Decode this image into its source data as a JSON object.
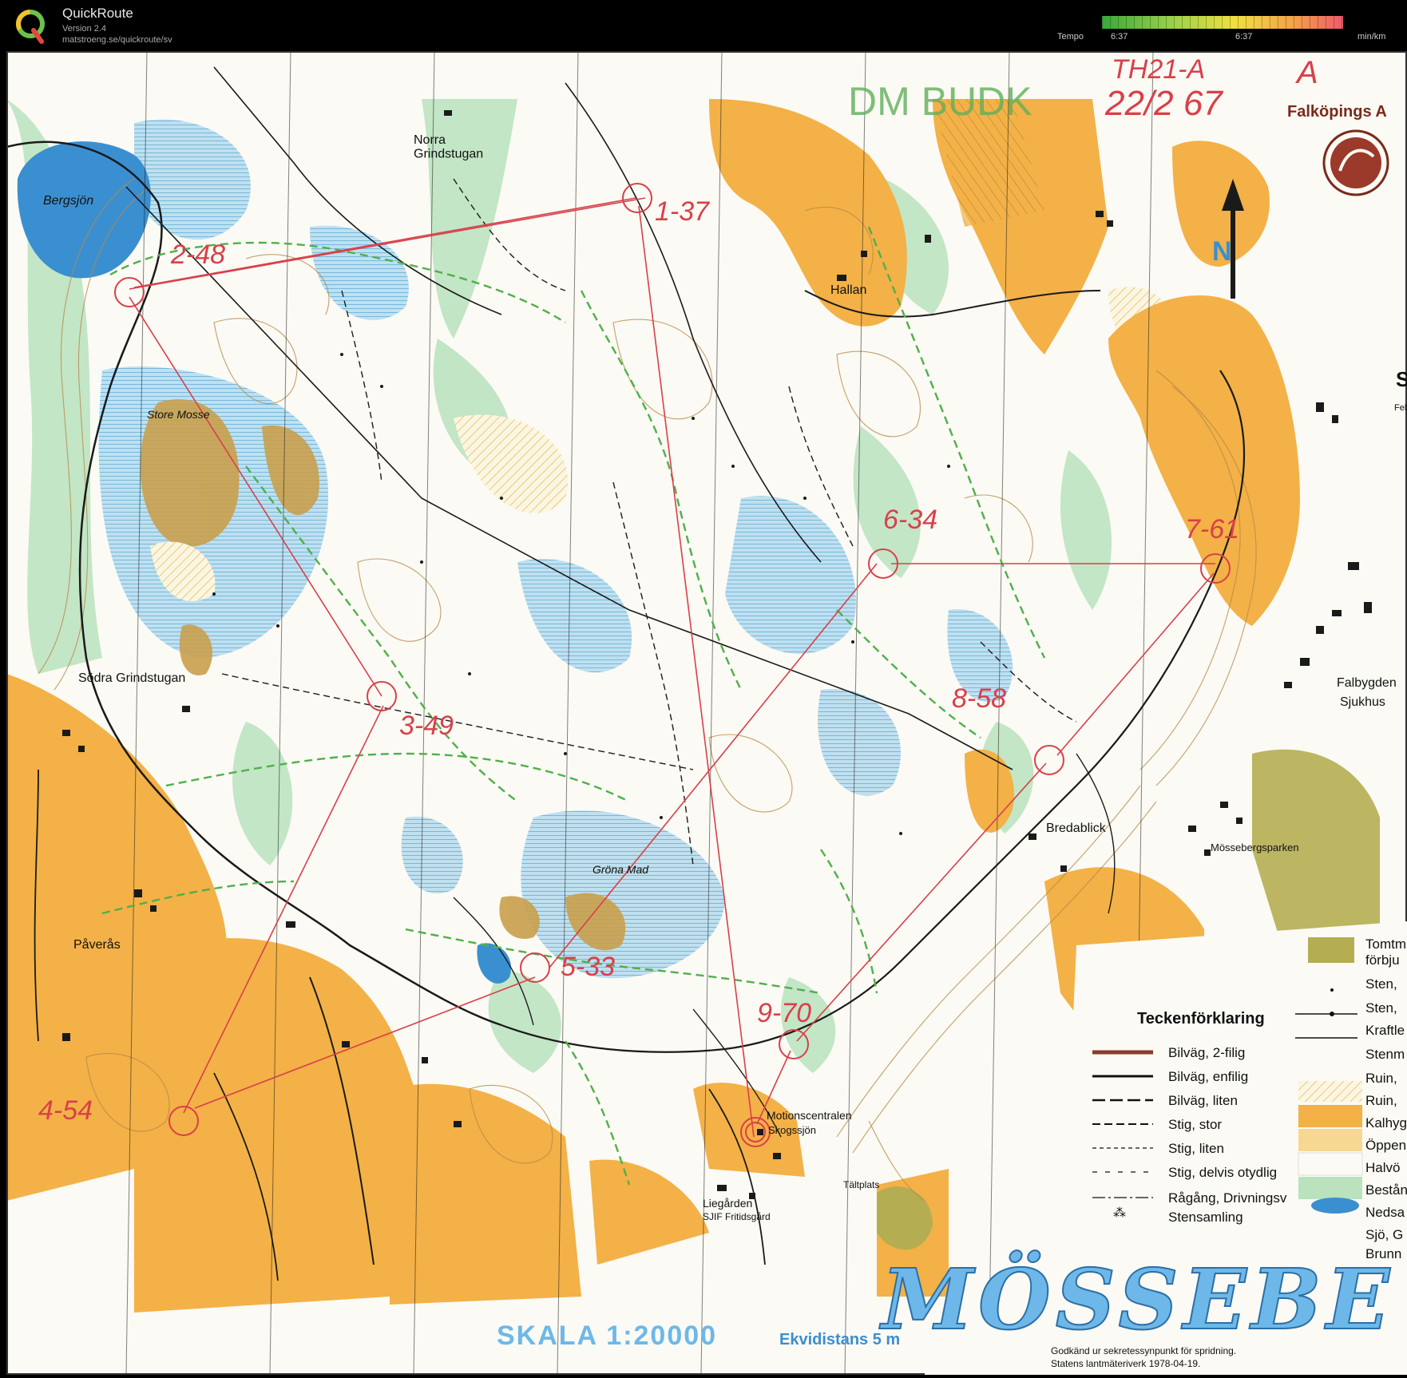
{
  "app": {
    "name": "QuickRoute",
    "version": "Version 2.4",
    "url": "matstroeng.se/quickroute/sv"
  },
  "tempo": {
    "label": "Tempo",
    "min": "6:37",
    "max": "6:37",
    "unit": "min/km",
    "colors": [
      "#3aa83a",
      "#9ed24a",
      "#f0e040",
      "#f4a04a",
      "#ee5a6a"
    ]
  },
  "map": {
    "handwritten_title": "DM BUDK",
    "handwritten_class": "TH21-A",
    "handwritten_date": "22/2 67",
    "handwritten_letter": "A",
    "club": "Falköpings A",
    "north": "N",
    "places": {
      "bergsjon": "Bergsjön",
      "norra": "Norra\nGrindstugan",
      "hallan": "Hallan",
      "store_mosse": "Store Mosse",
      "sodra": "Södra Grindstugan",
      "paveras": "Påverås",
      "grona_mad": "Gröna Mad",
      "bredablick": "Bredablick",
      "mosseberg": "Mössebergsparken",
      "falbygden": "Falbygden",
      "sjukhus": "Sjukhus",
      "motion": "Motionscentralen",
      "skogssjon": "Skogssjön",
      "liegarden": "Liegården",
      "sjif": "SJIF Fritidsgård",
      "taltplats": "Tältplats",
      "st": "St",
      "feb": "Feb"
    },
    "controls": [
      "1-37",
      "2-48",
      "3-49",
      "4-54",
      "5-33",
      "6-34",
      "7-61",
      "8-58",
      "9-70"
    ],
    "legend": {
      "title": "Teckenförklaring",
      "left_items": [
        "Bilväg, 2-filig",
        "Bilväg, enfilig",
        "Bilväg, liten",
        "Stig, stor",
        "Stig, liten",
        "Stig, delvis otydlig",
        "Rågång, Drivningsv",
        "Stensamling"
      ],
      "right_items": [
        "Tomtm",
        "förbju",
        "Sten,",
        "Sten,",
        "Kraftle",
        "Stenm",
        "Ruin,",
        "Ruin,",
        "Kalhyg",
        "Öppen",
        "Halvö",
        "Bestån",
        "Nedsa",
        "Sjö, G",
        "Brunn"
      ]
    },
    "map_title": "MÖSSEBE",
    "scale": "SKALA 1:20000",
    "contour": "Ekvidistans 5 m",
    "approval_1": "Godkänd ur sekretessynpunkt för spridning.",
    "approval_2": "Statens lantmäteriverk 1978-04-19."
  }
}
